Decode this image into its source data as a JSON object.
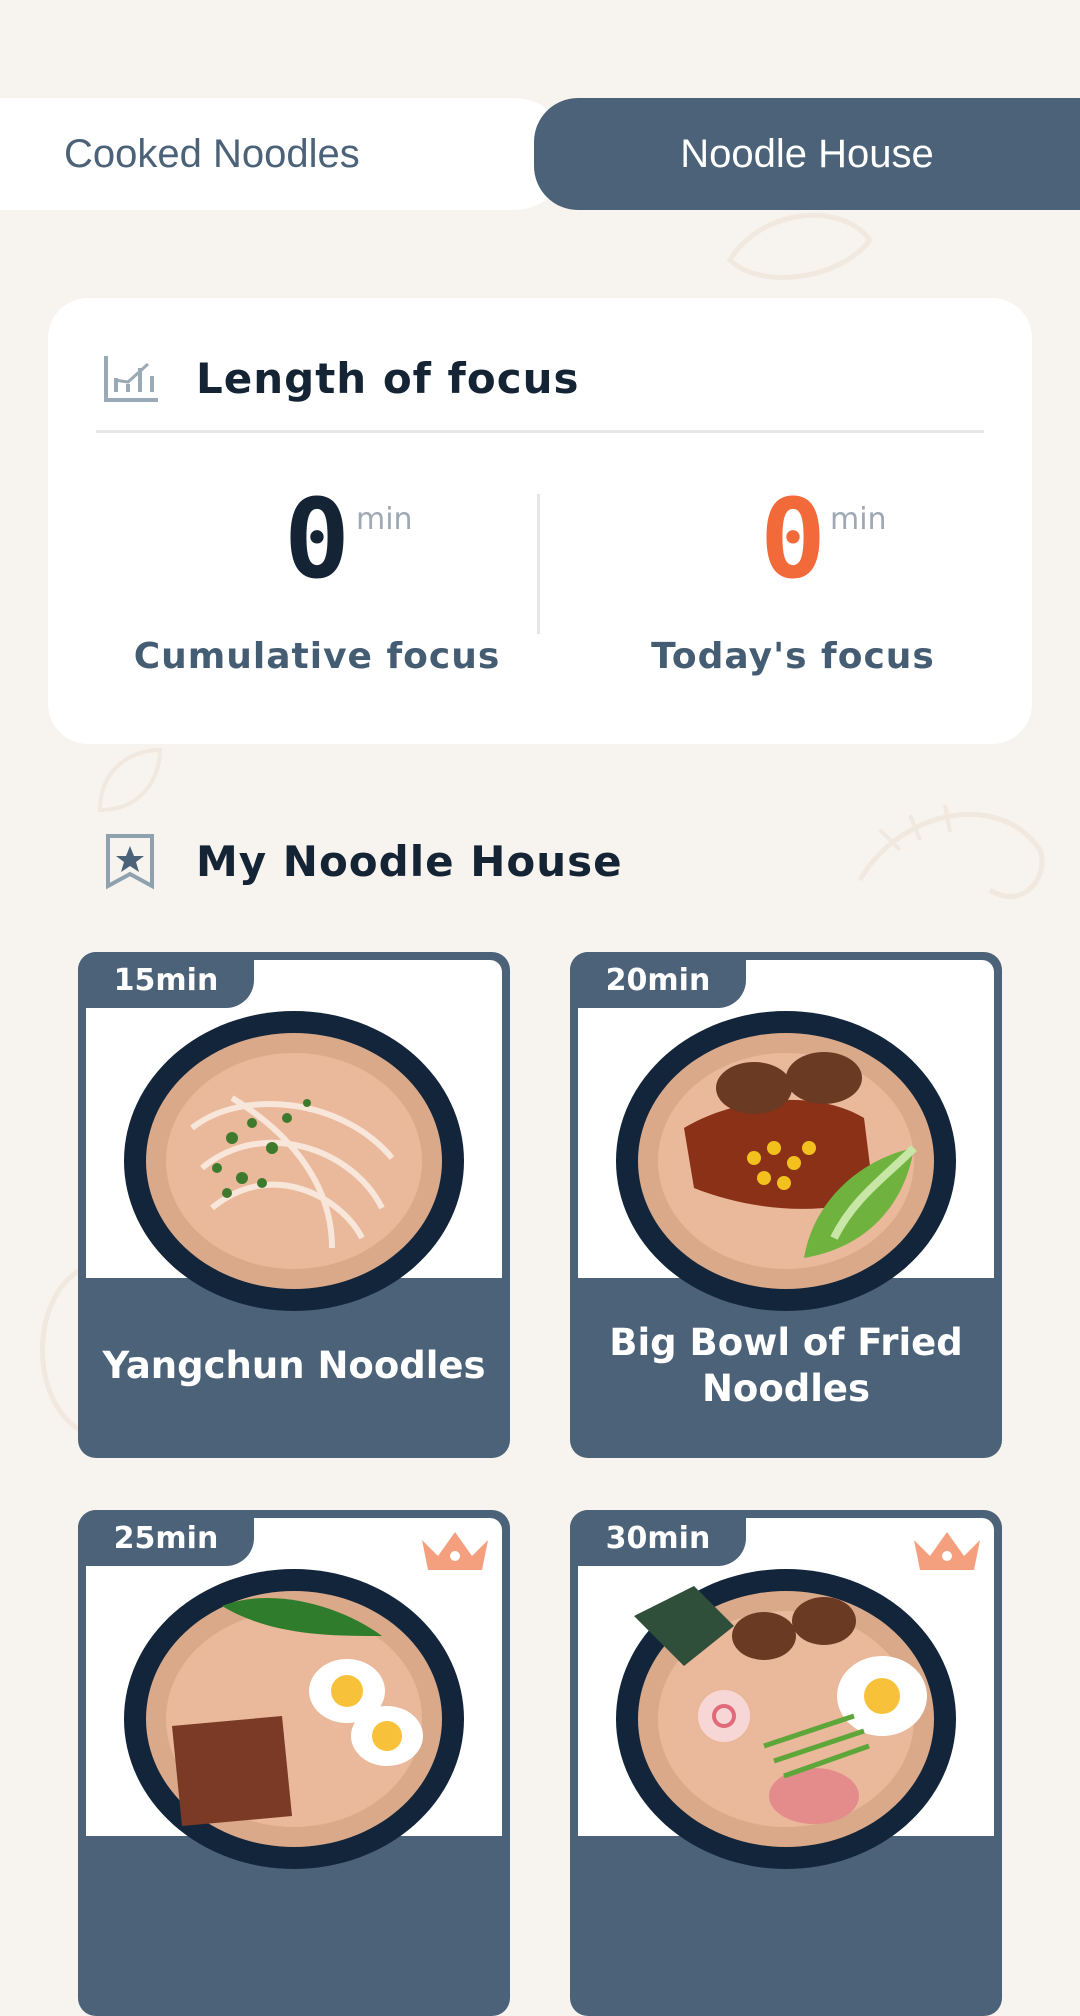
{
  "tabs": [
    {
      "label": "Cooked Noodles",
      "active": false
    },
    {
      "label": "Noodle House",
      "active": true
    }
  ],
  "focus": {
    "title": "Length of focus",
    "icon": "chart-icon",
    "cumulative": {
      "value": "0",
      "unit": "min",
      "label": "Cumulative focus",
      "color": "#152434"
    },
    "today": {
      "value": "0",
      "unit": "min",
      "label": "Today's focus",
      "color": "#f36a3a"
    }
  },
  "section": {
    "title": "My Noodle House",
    "icon": "bookmark-star-icon"
  },
  "noodles": [
    {
      "time": "15min",
      "name": "Yangchun Noodles",
      "premium": false
    },
    {
      "time": "20min",
      "name": "Big Bowl of Fried Noodles",
      "premium": false
    },
    {
      "time": "25min",
      "name": "",
      "premium": true
    },
    {
      "time": "30min",
      "name": "",
      "premium": true
    }
  ],
  "colors": {
    "accent": "#4b6278",
    "orange": "#f36a3a",
    "background": "#f7f3ee"
  }
}
